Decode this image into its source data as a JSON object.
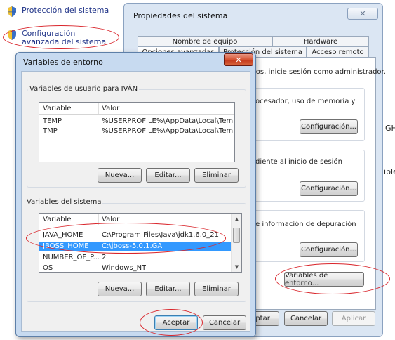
{
  "control_panel": {
    "links": [
      {
        "label": "Protección del sistema"
      },
      {
        "label": "Configuración avanzada del sistema"
      }
    ]
  },
  "system_properties": {
    "title": "Propiedades del sistema",
    "close_label": "✕",
    "tabs_row1": [
      "Nombre de equipo",
      "Hardware"
    ],
    "tabs_row2": [
      "Opciones avanzadas",
      "Protección del sistema",
      "Acceso remoto"
    ],
    "admin_note": "ios, inicie sesión como administrador.",
    "performance_text": "ocesador, uso de memoria y",
    "profile_text": "diente al inicio de sesión",
    "startup_text": "e información de depuración",
    "config_button": "Configuración...",
    "env_vars_button": "Variables de entorno...",
    "ok_button": "Aceptar",
    "cancel_button": "Cancelar",
    "apply_button": "Aplicar",
    "edge_text_1": "GH",
    "edge_text_2": "ible"
  },
  "env_dialog": {
    "title": "Variables de entorno",
    "close_label": "✕",
    "user_group_label": "Variables de usuario para IVÁN",
    "user_columns": [
      "Variable",
      "Valor"
    ],
    "user_vars": [
      {
        "name": "TEMP",
        "value": "%USERPROFILE%\\AppData\\Local\\Temp"
      },
      {
        "name": "TMP",
        "value": "%USERPROFILE%\\AppData\\Local\\Temp"
      }
    ],
    "system_group_label": "Variables del sistema",
    "system_columns": [
      "Variable",
      "Valor"
    ],
    "system_vars": [
      {
        "name": "JAVA_HOME",
        "value": "C:\\Program Files\\Java\\jdk1.6.0_21"
      },
      {
        "name": "JBOSS_HOME",
        "value": "C:\\jboss-5.0.1.GA"
      },
      {
        "name": "NUMBER_OF_P...",
        "value": "2"
      },
      {
        "name": "OS",
        "value": "Windows_NT"
      }
    ],
    "new_button": "Nueva...",
    "edit_button": "Editar...",
    "delete_button": "Eliminar",
    "ok_button": "Aceptar",
    "cancel_button": "Cancelar"
  },
  "colors": {
    "highlight_ellipse": "#d9252b",
    "selection": "#3399ff",
    "link": "#1e3287"
  }
}
